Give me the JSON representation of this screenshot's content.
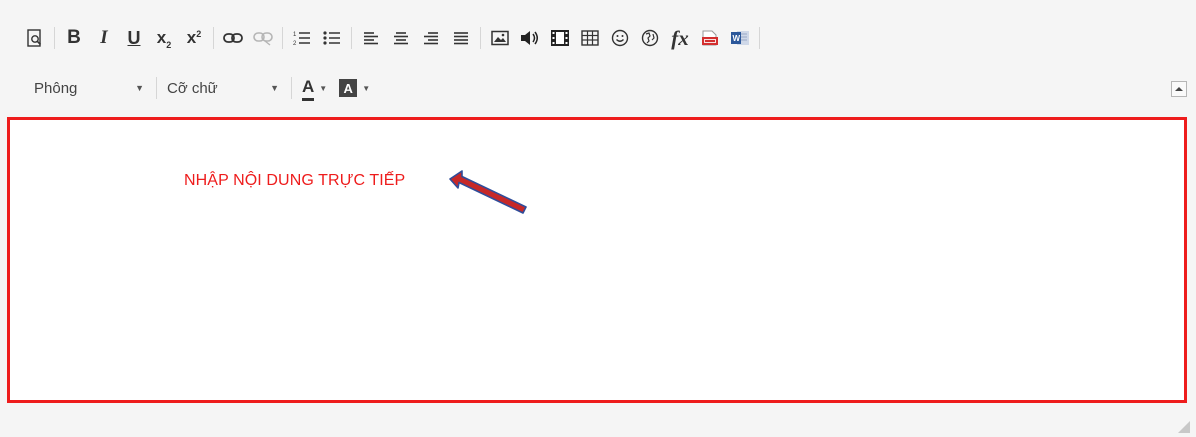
{
  "toolbar": {
    "row1_icons": [
      "preview-icon",
      "bold-icon",
      "italic-icon",
      "underline-icon",
      "subscript-icon",
      "superscript-icon",
      "link-icon",
      "unlink-icon",
      "numbered-list-icon",
      "bulleted-list-icon",
      "align-left-icon",
      "align-center-icon",
      "align-right-icon",
      "justify-icon",
      "image-icon",
      "audio-icon",
      "video-icon",
      "table-icon",
      "emoji-icon",
      "globe-icon",
      "formula-icon",
      "pdf-icon",
      "word-icon"
    ],
    "bold_glyph": "B",
    "italic_glyph": "I",
    "underline_glyph": "U",
    "subscript_glyph": "x",
    "subscript_mark": "2",
    "superscript_glyph": "x",
    "superscript_mark": "2",
    "formula_glyph": "fx",
    "font_select_value": "Phông",
    "size_select_value": "Cỡ chữ",
    "text_color_glyph": "A",
    "background_color_glyph": "A"
  },
  "content": {
    "text": "NHẬP NỘI DUNG TRỰC TIẾP"
  },
  "colors": {
    "highlight_border": "#ee1c1c",
    "content_text": "#ee1c1c",
    "arrow_fill": "#c62828",
    "arrow_outline": "#2f4d9a",
    "toolbar_bg": "#f5f5f5"
  }
}
